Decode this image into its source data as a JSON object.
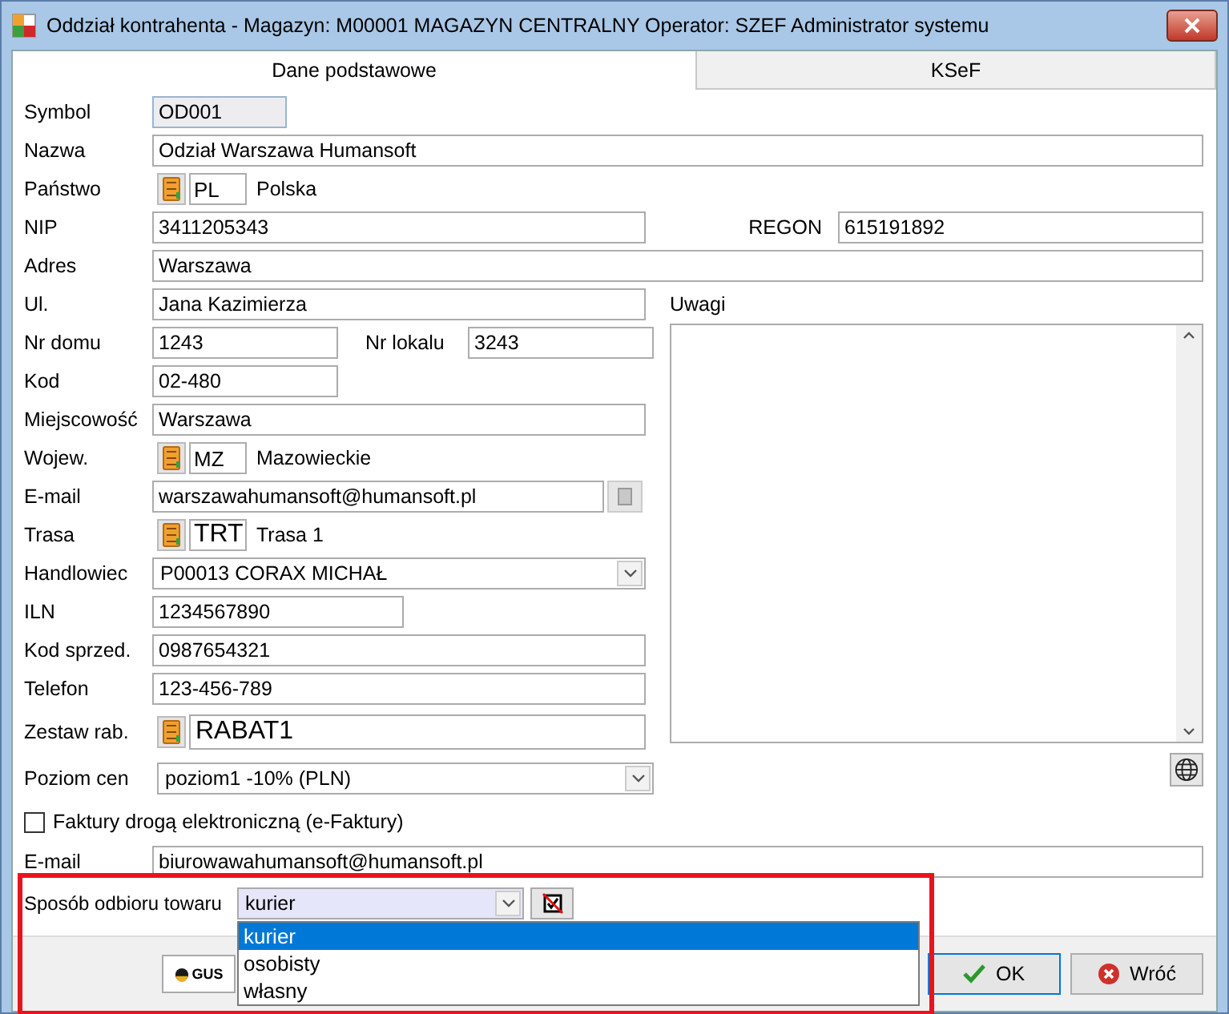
{
  "window": {
    "title": "Oddział kontrahenta - Magazyn: M00001 MAGAZYN CENTRALNY  Operator: SZEF Administrator systemu"
  },
  "tabs": [
    {
      "label": "Dane podstawowe",
      "selected": true
    },
    {
      "label": "KSeF",
      "selected": false
    }
  ],
  "symbol": {
    "label": "Symbol",
    "value": "OD001"
  },
  "nazwa": {
    "label": "Nazwa",
    "value": "Odział Warszawa Humansoft"
  },
  "panstwo": {
    "label": "Państwo",
    "code": "PL",
    "name": "Polska"
  },
  "nip": {
    "label": "NIP",
    "value": "3411205343"
  },
  "regon": {
    "label": "REGON",
    "value": "615191892"
  },
  "adres": {
    "label": "Adres",
    "value": "Warszawa"
  },
  "ulica": {
    "label": "Ul.",
    "value": "Jana Kazimierza"
  },
  "nr_domu": {
    "label": "Nr domu",
    "value": "1243"
  },
  "nr_lokalu": {
    "label": "Nr lokalu",
    "value": "3243"
  },
  "kod": {
    "label": "Kod",
    "value": "02-480"
  },
  "miejscowosc": {
    "label": "Miejscowość",
    "value": "Warszawa"
  },
  "wojew": {
    "label": "Wojew.",
    "code": "MZ",
    "name": "Mazowieckie"
  },
  "email": {
    "label": "E-mail",
    "value": "warszawahumansoft@humansoft.pl"
  },
  "trasa": {
    "label": "Trasa",
    "code": "TRT",
    "name": "Trasa 1"
  },
  "handlowiec": {
    "label": "Handlowiec",
    "value": "P00013 CORAX MICHAŁ"
  },
  "iln": {
    "label": "ILN",
    "value": "1234567890"
  },
  "kod_sprzed": {
    "label": "Kod sprzed.",
    "value": "0987654321"
  },
  "telefon": {
    "label": "Telefon",
    "value": "123-456-789"
  },
  "zestaw_rab": {
    "label": "Zestaw rab.",
    "code": "RABAT1"
  },
  "poziom_cen": {
    "label": "Poziom cen",
    "value": "poziom1 -10% (PLN)"
  },
  "uwagi": {
    "label": "Uwagi"
  },
  "e_faktury": {
    "label": "Faktury drogą elektroniczną (e-Faktury)",
    "checked": false
  },
  "email_faktury": {
    "label": "E-mail",
    "value": "biurowawahumansoft@humansoft.pl"
  },
  "sposob_odbioru": {
    "label": "Sposób odbioru towaru",
    "value": "kurier",
    "options": [
      {
        "label": "kurier",
        "selected": true
      },
      {
        "label": "osobisty",
        "selected": false
      },
      {
        "label": "własny",
        "selected": false
      }
    ]
  },
  "gus_button": {
    "label": "GUS"
  },
  "buttons": [
    {
      "label": "OK",
      "kind": "ok"
    },
    {
      "label": "Wróć",
      "kind": "cancel"
    }
  ]
}
